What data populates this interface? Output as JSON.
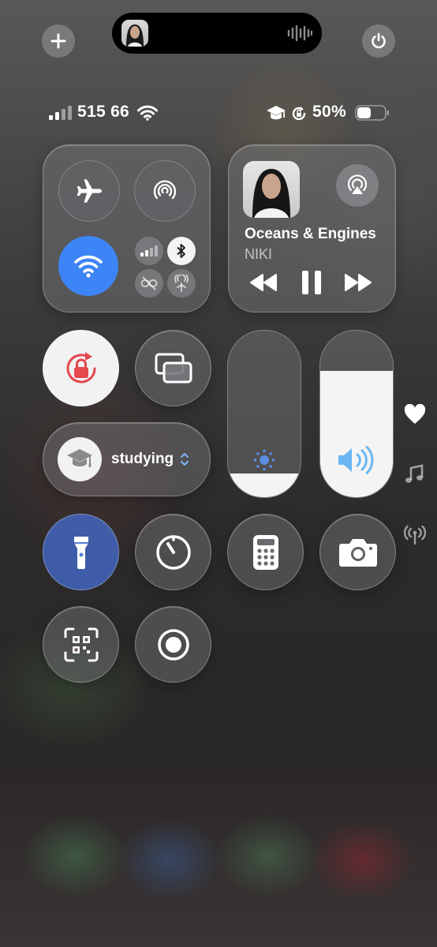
{
  "top_bar": {
    "add_icon": "plus-icon",
    "power_icon": "power-icon",
    "island": {
      "album_art": "album-art-thumbnail",
      "waveform_icon": "waveform-icon"
    }
  },
  "status_bar": {
    "carrier": "515 66",
    "battery_percent": "50%",
    "battery_level": 0.5,
    "icons": [
      "cellular-signal-icon",
      "wifi-icon",
      "graduation-cap-icon",
      "orientation-lock-icon",
      "battery-icon"
    ]
  },
  "connectivity": {
    "airplane_mode": false,
    "airdrop": false,
    "wifi": true,
    "cellular": false,
    "bluetooth": true,
    "vpn": false,
    "personal_hotspot": false
  },
  "now_playing": {
    "title": "Oceans & Engines",
    "artist": "NIKI",
    "controls": [
      "rewind-icon",
      "pause-icon",
      "fast-forward-icon"
    ],
    "airplay_icon": "airplay-audio-icon"
  },
  "controls": {
    "orientation_lock": true,
    "screen_mirroring": false,
    "focus": {
      "label": "studying",
      "icon": "graduation-cap-icon"
    },
    "flashlight": true,
    "timer": false,
    "calculator": false,
    "camera": false,
    "code_scanner": false,
    "screen_record": false
  },
  "sliders": {
    "brightness_level": 0.14,
    "volume_level": 0.76
  },
  "side_icons": [
    "heart-icon",
    "music-note-icon",
    "antenna-icon"
  ],
  "colors": {
    "accent_blue": "#3d85f6",
    "lock_red": "#e5484d",
    "volume_blue": "#6ab7f3"
  }
}
